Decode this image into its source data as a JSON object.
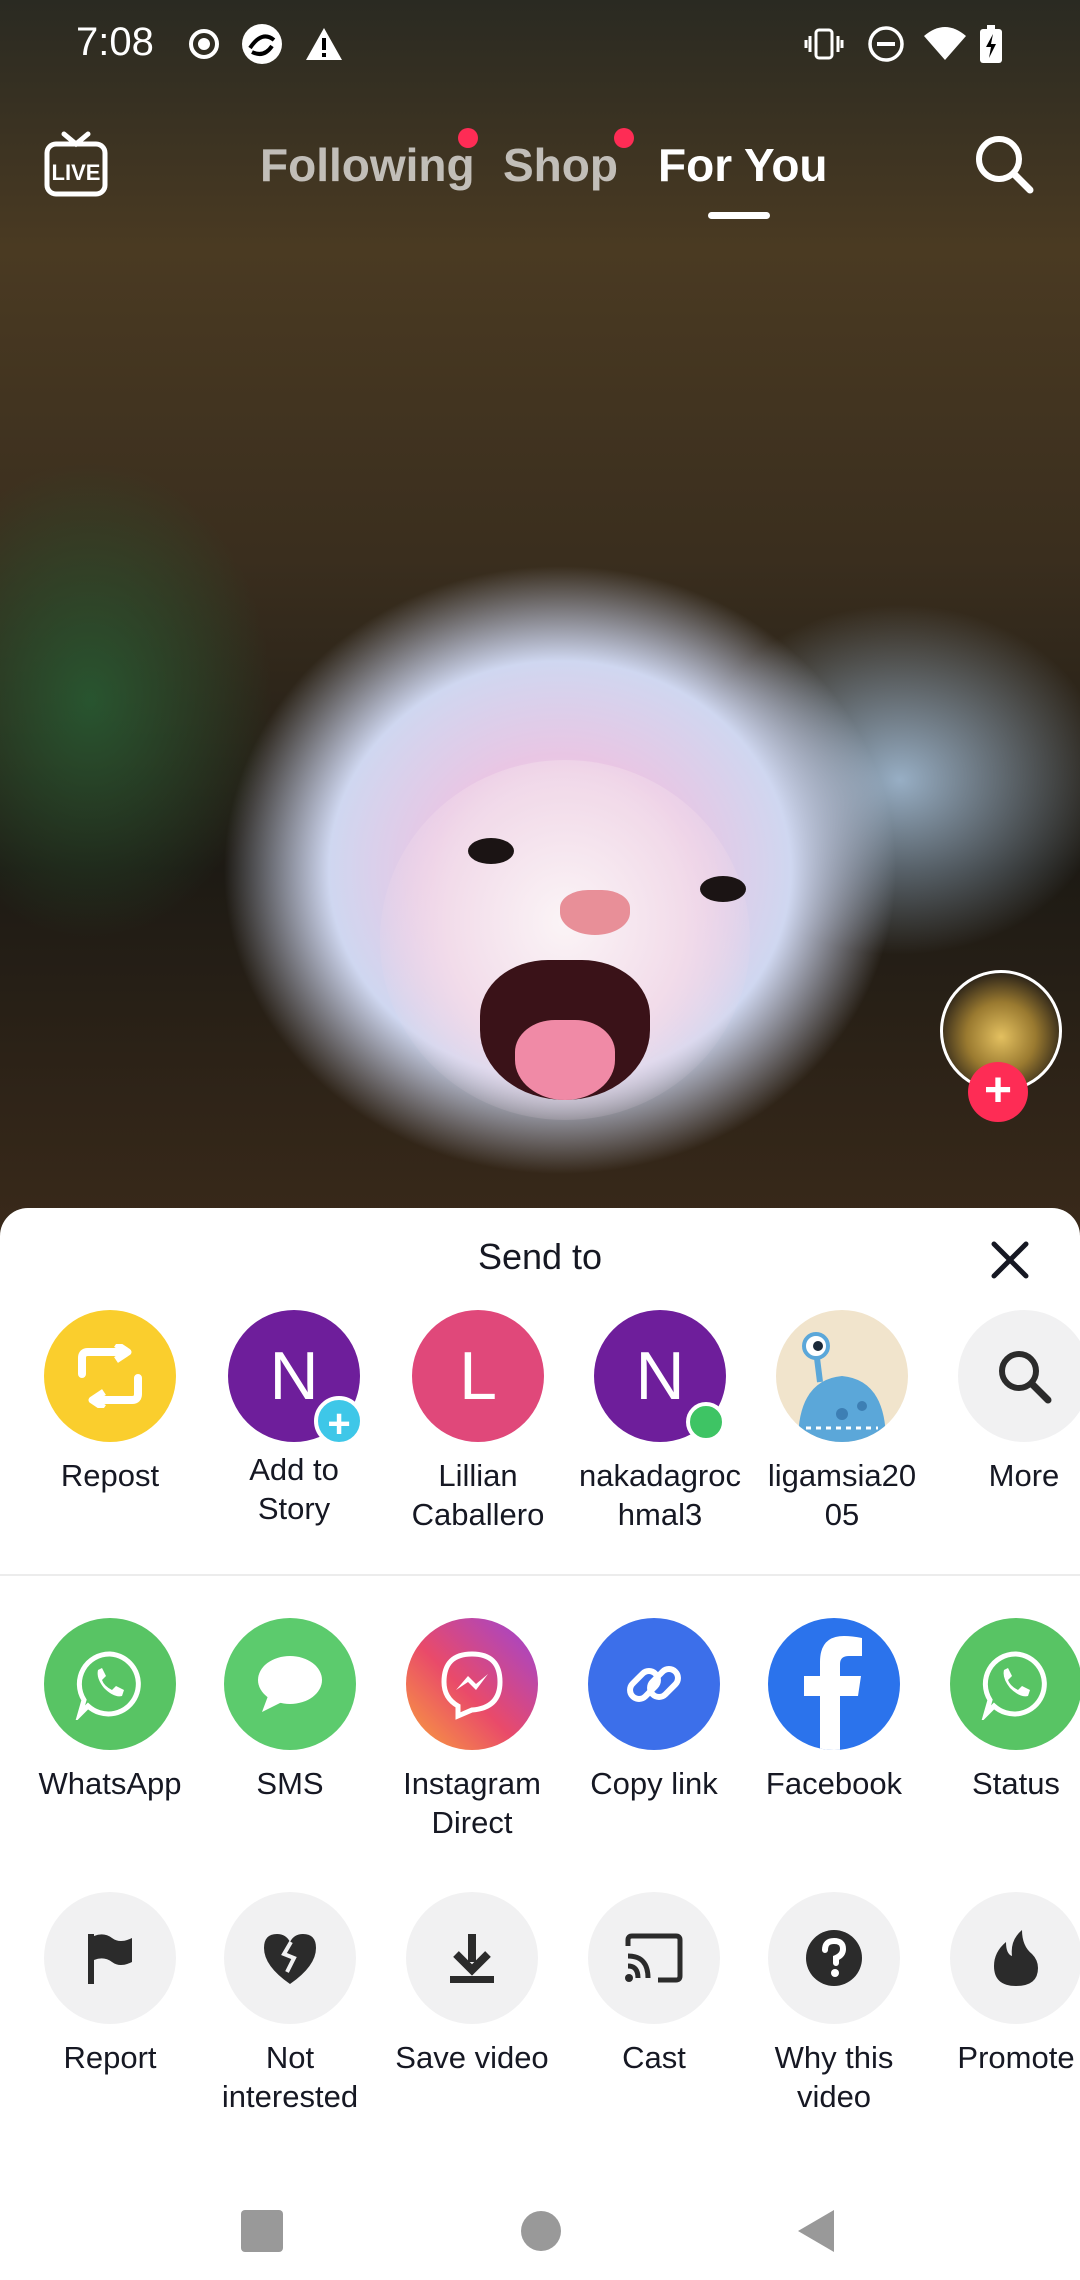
{
  "status_bar": {
    "time": "7:08",
    "left_icons": [
      "record-icon",
      "app-icon",
      "warning-icon"
    ],
    "right_icons": [
      "vibrate-icon",
      "do-not-disturb-icon",
      "wifi-icon",
      "battery-charging-icon"
    ]
  },
  "top_nav": {
    "live_icon": "live-icon",
    "tabs": [
      {
        "label": "Following",
        "active": false,
        "has_dot": true
      },
      {
        "label": "Shop",
        "active": false,
        "has_dot": true
      },
      {
        "label": "For You",
        "active": true,
        "has_dot": false
      }
    ],
    "search_icon": "search-icon"
  },
  "share_sheet": {
    "title": "Send to",
    "close_icon": "close-icon",
    "contacts": [
      {
        "label": "Repost",
        "icon": "repost-icon",
        "color": "#FACE2D"
      },
      {
        "label": "Add to\nStory",
        "letter": "N",
        "color": "#6E1E9B",
        "badge": "plus"
      },
      {
        "label": "Lillian\nCaballero",
        "letter": "L",
        "color": "#E0487A"
      },
      {
        "label": "nakadagroc\nhmal3",
        "letter": "N",
        "color": "#6E1E9B",
        "badge": "online"
      },
      {
        "label": "ligamsia20\n05",
        "icon": "alien-avatar-icon",
        "color": "#F1E4CC"
      },
      {
        "label": "More",
        "icon": "search-icon",
        "color": "#F1F1F2"
      }
    ],
    "apps": [
      {
        "label": "WhatsApp",
        "icon": "whatsapp-icon",
        "color": "#58C464"
      },
      {
        "label": "SMS",
        "icon": "sms-icon",
        "color": "#5CCB6D"
      },
      {
        "label": "Instagram\nDirect",
        "icon": "messenger-icon",
        "color": "#D9468E"
      },
      {
        "label": "Copy link",
        "icon": "link-icon",
        "color": "#3C6FEA"
      },
      {
        "label": "Facebook",
        "icon": "facebook-icon",
        "color": "#2B73EC"
      },
      {
        "label": "Status",
        "icon": "whatsapp-icon",
        "color": "#58C464"
      }
    ],
    "actions": [
      {
        "label": "Report",
        "icon": "flag-icon"
      },
      {
        "label": "Not\ninterested",
        "icon": "broken-heart-icon"
      },
      {
        "label": "Save video",
        "icon": "download-icon"
      },
      {
        "label": "Cast",
        "icon": "cast-icon"
      },
      {
        "label": "Why this\nvideo",
        "icon": "question-icon"
      },
      {
        "label": "Promote",
        "icon": "flame-icon"
      }
    ]
  },
  "system_nav": {
    "icons": [
      "recents-icon",
      "home-icon",
      "back-icon"
    ]
  }
}
